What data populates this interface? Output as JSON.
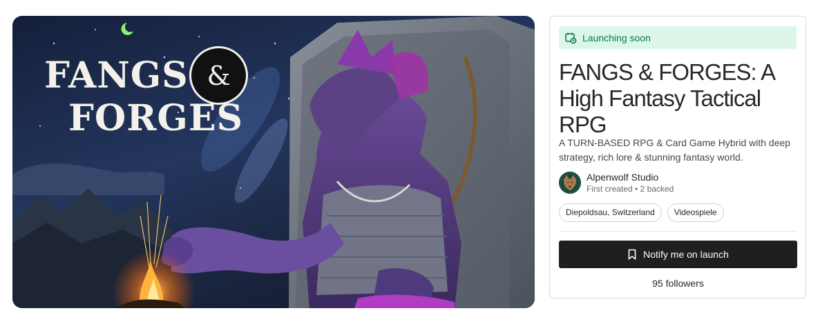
{
  "hero": {
    "logo_line1": "FANGS",
    "logo_line2": "FORGES",
    "logo_amp": "&"
  },
  "card": {
    "status": {
      "label": "Launching soon",
      "icon": "calendar-clock-icon",
      "bg": "#dcf7ea",
      "color": "#027a4a"
    },
    "title": "FANGS & FORGES: A High Fantasy Tactical RPG",
    "blurb": "A TURN-BASED RPG & Card Game Hybrid with deep strategy, rich lore & stunning fantasy world.",
    "creator": {
      "name": "Alpenwolf Studio",
      "meta": "First created • 2 backed",
      "avatar": "wolf-avatar"
    },
    "tags": [
      "Diepoldsau, Switzerland",
      "Videospiele"
    ],
    "notify_button": {
      "label": "Notify me on launch",
      "icon": "bookmark-icon",
      "bg": "#1f1f1f"
    },
    "followers": "95 followers"
  }
}
